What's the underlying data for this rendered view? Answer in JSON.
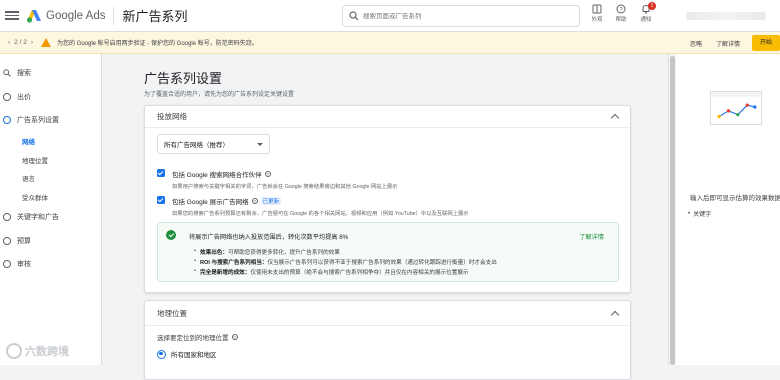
{
  "header": {
    "logo_text": "Google Ads",
    "campaign_title": "新广告系列",
    "search_placeholder": "搜索页面或广告系列",
    "tools": [
      {
        "label": "外观",
        "icon": "appearance-icon"
      },
      {
        "label": "帮助",
        "icon": "help-icon"
      },
      {
        "label": "通知",
        "icon": "bell-icon",
        "badge": "1"
      }
    ]
  },
  "notice": {
    "pager": "2 / 2",
    "message": "为您的 Google 帐号启用两步验证 - 保护您的 Google 帐号，防范密码失窃。",
    "dismiss": "忽略",
    "learn_more": "了解详情",
    "start": "开始"
  },
  "sidebar": {
    "items": [
      {
        "label": "搜索",
        "icon": "search-icon"
      },
      {
        "label": "出价",
        "icon": "circle-icon"
      },
      {
        "label": "广告系列设置",
        "icon": "circle-icon"
      },
      {
        "label": "关键字和广告",
        "icon": "circle-icon"
      },
      {
        "label": "预算",
        "icon": "circle-icon"
      },
      {
        "label": "审核",
        "icon": "circle-icon"
      }
    ],
    "subitems": [
      "网络",
      "地理位置",
      "语言",
      "受众群体"
    ],
    "watermark": "六数跨境"
  },
  "main": {
    "title": "广告系列设置",
    "subtitle": "为了覆盖合适的用户，请先为您的广告系列设定关键设置",
    "network_card": {
      "header": "投放网络",
      "select_value": "所有广告网络（推荐）",
      "search_partners": {
        "label": "包括 Google 搜索网络合作伙伴",
        "desc": "如果用户搜索与关键字相关的字词，广告就会在 Google 搜索结果旁边和其他 Google 网站上展示"
      },
      "display_network": {
        "label": "包括 Google 展示广告网络",
        "tag": "已更新",
        "desc": "如果您的搜索广告系列预算还有剩余，广告便可在 Google 的各个相关网站、视频和应用（例如 YouTube）中以及互联网上展示"
      },
      "tip": {
        "headline": "将展示广告网络也纳入投放范围后，转化次数平均提高 8%",
        "link": "了解详情",
        "bullets": [
          {
            "bold": "效果出色：",
            "text": "可帮助您获得更多转化，提升广告系列的效果"
          },
          {
            "bold": "ROI 与搜索广告系列相当：",
            "text": "仅当展示广告系列可以获得不亚于搜索广告系列的效果（通过转化跟踪进行衡量）时才会支出"
          },
          {
            "bold": "完全是新增的成效：",
            "text": "仅使用未支出的预算（绝不会与搜索广告系列相争夺）并且仅在内容相关的展示位置展示"
          }
        ]
      }
    },
    "location_card": {
      "header": "地理位置",
      "prompt": "选择要定位到的地理位置",
      "option_all": "所有国家和地区"
    }
  },
  "right_panel": {
    "text": "输入后即可显示估算的效果数据",
    "bullet": "关键字"
  },
  "colors": {
    "primary_blue": "#1a73e8",
    "success_green": "#1e8e3e",
    "warning_yellow": "#fbbc04",
    "notice_bg": "#fef7e0"
  }
}
